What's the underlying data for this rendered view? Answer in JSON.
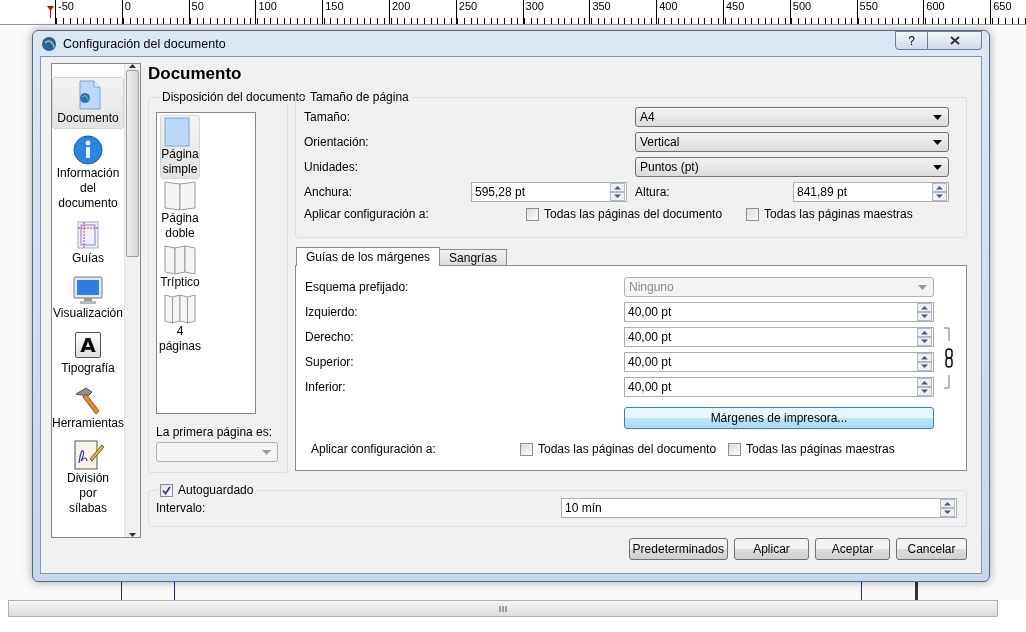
{
  "ruler": {
    "labels": [
      "-50",
      "0",
      "50",
      "100",
      "150",
      "200",
      "250",
      "300",
      "350",
      "400",
      "450",
      "500",
      "550",
      "600",
      "650"
    ]
  },
  "dialog": {
    "title": "Configuración del documento",
    "help": "?"
  },
  "sidebar": {
    "items": [
      {
        "label": "Documento",
        "selected": true
      },
      {
        "label": "Información del documento",
        "selected": false
      },
      {
        "label": "Guías",
        "selected": false
      },
      {
        "label": "Visualización",
        "selected": false
      },
      {
        "label": "Tipografía",
        "selected": false,
        "glyph": "A"
      },
      {
        "label": "Herramientas",
        "selected": false
      },
      {
        "label": "División por sílabas",
        "selected": false
      }
    ]
  },
  "heading": "Documento",
  "layout": {
    "title": "Disposición del documento",
    "items": [
      {
        "label": "Página simple",
        "selected": true
      },
      {
        "label": "Página doble",
        "selected": false
      },
      {
        "label": "Tríptico",
        "selected": false
      },
      {
        "label": "4 páginas",
        "selected": false
      }
    ],
    "first_page_label": "La primera página es:",
    "first_page_disabled": true
  },
  "page_size": {
    "title": "Tamaño de página",
    "size": {
      "label": "Tamaño:",
      "value": "A4"
    },
    "orientation": {
      "label": "Orientación:",
      "value": "Vertical"
    },
    "units": {
      "label": "Unidades:",
      "value": "Puntos (pt)"
    },
    "width": {
      "label": "Anchura:",
      "value": "595,28 pt"
    },
    "height": {
      "label": "Altura:",
      "value": "841,89 pt"
    },
    "apply": {
      "label": "Aplicar configuración a:",
      "options": [
        {
          "label": "Todas las páginas del documento",
          "checked": false
        },
        {
          "label": "Todas las páginas maestras",
          "checked": false
        }
      ]
    }
  },
  "tabs": [
    {
      "label": "Guías de los márgenes",
      "selected": true
    },
    {
      "label": "Sangrías",
      "selected": false
    }
  ],
  "margins": {
    "preset": {
      "label": "Esquema prefijado:",
      "value": "Ninguno",
      "disabled": true
    },
    "fields": [
      {
        "label": "Izquierdo:",
        "value": "40,00 pt"
      },
      {
        "label": "Derecho:",
        "value": "40,00 pt"
      },
      {
        "label": "Superior:",
        "value": "40,00 pt"
      },
      {
        "label": "Inferior:",
        "value": "40,00 pt"
      }
    ],
    "printer_button": "Márgenes de impresora...",
    "apply": {
      "label": "Aplicar configuración a:",
      "options": [
        {
          "label": "Todas las páginas del documento",
          "checked": false
        },
        {
          "label": "Todas las páginas maestras",
          "checked": false
        }
      ]
    }
  },
  "autosave": {
    "label": "Autoguardado",
    "checked": true,
    "interval_label": "Intervalo:",
    "interval_value": "10 mín"
  },
  "buttons": [
    "Predeterminados",
    "Aplicar",
    "Aceptar",
    "Cancelar"
  ]
}
